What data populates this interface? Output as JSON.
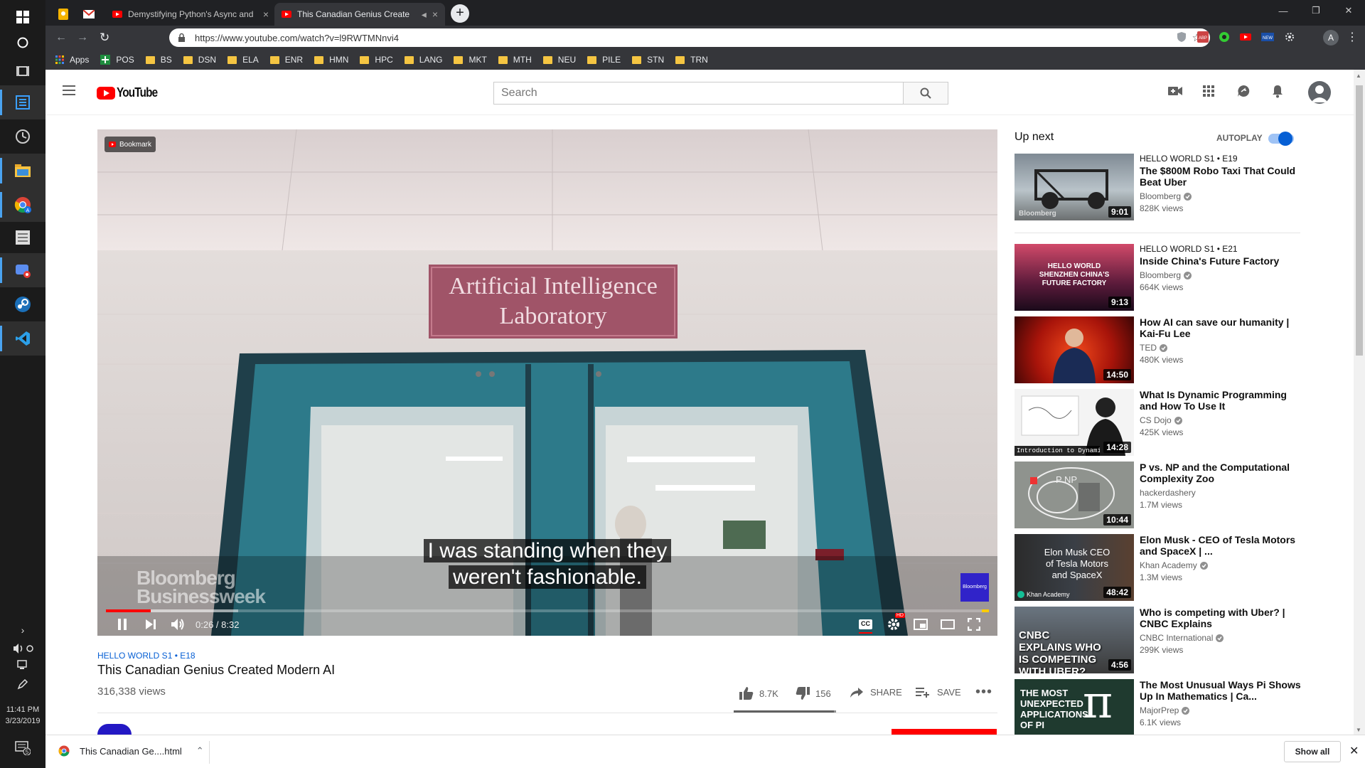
{
  "taskbar": {
    "time": "11:41 PM",
    "date": "3/23/2019",
    "notification_count": "5"
  },
  "browser": {
    "tabs": [
      {
        "title": ""
      },
      {
        "title": ""
      },
      {
        "title": "Demystifying Python's Async and"
      },
      {
        "title": "This Canadian Genius Create"
      }
    ],
    "url": "https://www.youtube.com/watch?v=l9RWTMNnvi4",
    "bookmarks": [
      "Apps",
      "POS",
      "BS",
      "DSN",
      "ELA",
      "ENR",
      "HMN",
      "HPC",
      "LANG",
      "MKT",
      "MTH",
      "NEU",
      "PILE",
      "STN",
      "TRN"
    ],
    "new_tab": "+",
    "profile": "A"
  },
  "youtube": {
    "logo": "YouTube",
    "search_placeholder": "Search"
  },
  "video": {
    "bookmark_chip": "Bookmark",
    "sign_line1": "Artificial Intelligence",
    "sign_line2": "Laboratory",
    "watermark_line1": "Bloomberg",
    "watermark_line2": "Businessweek",
    "watermark_badge": "Bloomberg",
    "subtitle_line1": "I was standing when they",
    "subtitle_line2": "weren't fashionable.",
    "time": "0:26 / 8:32",
    "progress_fraction": 0.051,
    "buffered_fraction": 0.15,
    "cc_label": "CC",
    "hd_label": "HD"
  },
  "meta": {
    "series": "HELLO WORLD  S1 • E18",
    "title": "This Canadian Genius Created Modern AI",
    "views": "316,338 views",
    "likes": "8.7K",
    "dislikes": "156",
    "share": "SHARE",
    "save": "SAVE"
  },
  "sidebar": {
    "up_next": "Up next",
    "autoplay": "AUTOPLAY",
    "items": [
      {
        "series": "HELLO WORLD  S1 • E19",
        "title": "The $800M Robo Taxi That Could Beat Uber",
        "channel": "Bloomberg",
        "views": "828K views",
        "duration": "9:01",
        "thumb_text": "Bloomberg"
      },
      {
        "series": "HELLO WORLD  S1 • E21",
        "title": "Inside China's Future Factory",
        "channel": "Bloomberg",
        "views": "664K views",
        "duration": "9:13",
        "thumb_text": "HELLO WORLD SHENZHEN CHINA'S FUTURE FACTORY"
      },
      {
        "series": "",
        "title": "How AI can save our humanity | Kai-Fu Lee",
        "channel": "TED",
        "views": "480K views",
        "duration": "14:50",
        "thumb_text": ""
      },
      {
        "series": "",
        "title": "What Is Dynamic Programming and How To Use It",
        "channel": "CS Dojo",
        "views": "425K views",
        "duration": "14:28",
        "thumb_text": "Introduction to Dynamic Prog"
      },
      {
        "series": "",
        "title": "P vs. NP and the Computational Complexity Zoo",
        "channel": "hackerdashery",
        "views": "1.7M views",
        "duration": "10:44",
        "thumb_text": "P  NP"
      },
      {
        "series": "",
        "title": "Elon Musk - CEO of Tesla Motors and SpaceX | ...",
        "channel": "Khan Academy",
        "views": "1.3M views",
        "duration": "48:42",
        "thumb_text": "Elon Musk CEO of Tesla Motors and SpaceX"
      },
      {
        "series": "",
        "title": "Who is competing with Uber? | CNBC Explains",
        "channel": "CNBC International",
        "views": "299K views",
        "duration": "4:56",
        "thumb_text": "CNBC EXPLAINS WHO IS COMPETING WITH UBER?"
      },
      {
        "series": "",
        "title": "The Most Unusual Ways Pi Shows Up In Mathematics | Ca...",
        "channel": "MajorPrep",
        "views": "6.1K views",
        "duration": "",
        "thumb_text": "THE MOST UNEXPECTED APPLICATIONS OF PI"
      }
    ]
  },
  "downloads": {
    "file": "This Canadian Ge....html",
    "show_all": "Show all"
  }
}
